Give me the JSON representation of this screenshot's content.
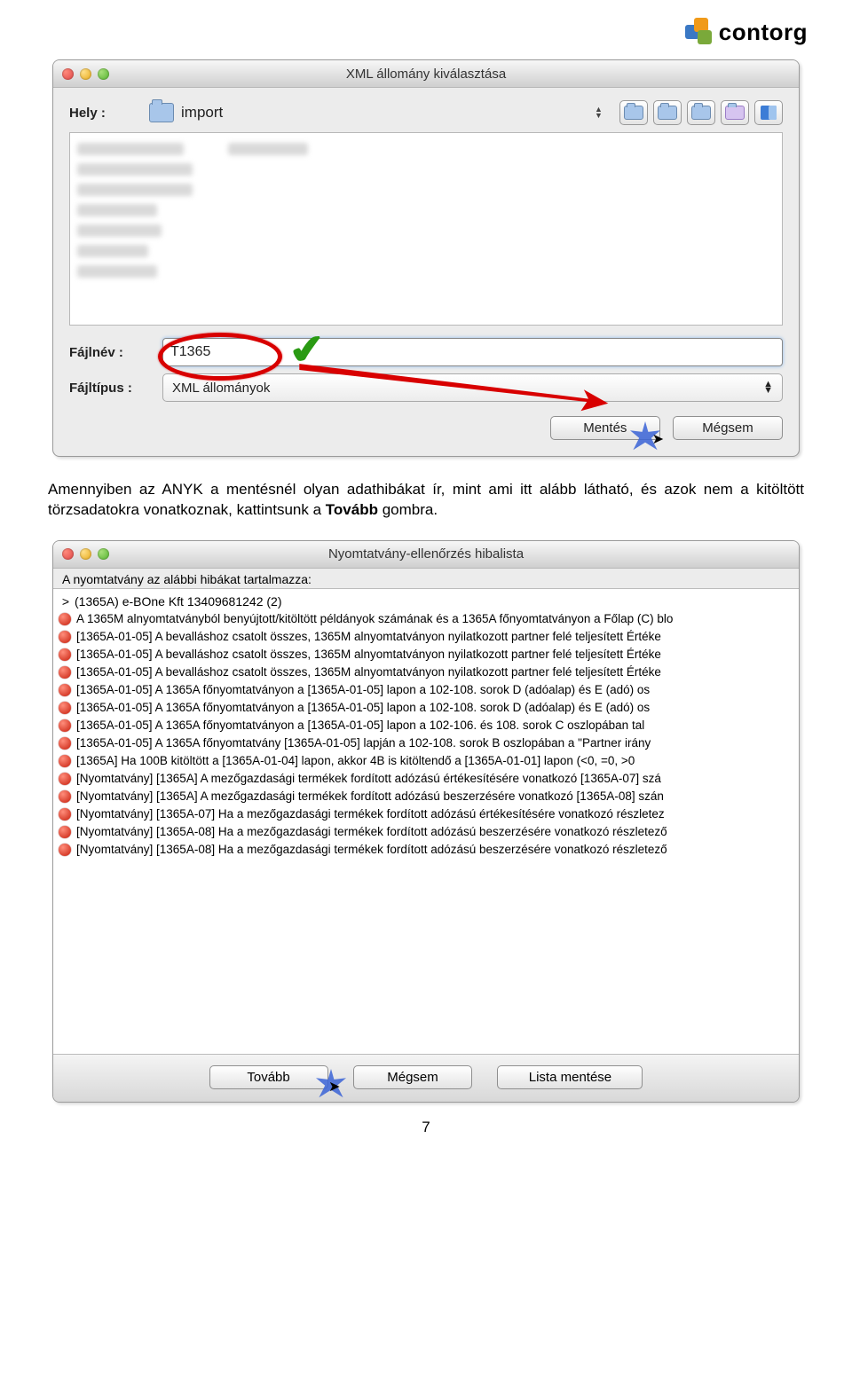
{
  "logo": {
    "text": "contorg"
  },
  "dialog1": {
    "title": "XML állomány kiválasztása",
    "location_label": "Hely :",
    "location_value": "import",
    "filename_label": "Fájlnév :",
    "filename_value": "T1365",
    "filetype_label": "Fájltípus :",
    "filetype_value": "XML állományok",
    "save_btn": "Mentés",
    "cancel_btn": "Mégsem"
  },
  "paragraph": {
    "p1a": "Amennyiben az ANYK a mentésnél olyan adathibákat ír, mint ami itt alább látható, és azok nem a kitöltött törzsadatokra vonatkoznak, kattintsunk a ",
    "p1b": "Tovább",
    "p1c": " gombra."
  },
  "dialog2": {
    "title": "Nyomtatvány-ellenőrzés hibalista",
    "intro": "A nyomtatvány az alábbi hibákat tartalmazza:",
    "header_line": "(1365A) e-BOne Kft 13409681242 (2)",
    "errors": [
      "A 1365M alnyomtatványból benyújtott/kitöltött példányok  számának és a 1365A főnyomtatványon a Főlap (C) blo",
      "[1365A-01-05] A bevalláshoz csatolt összes, 1365M  alnyomtatványon nyilatkozott partner felé teljesített  Értéke",
      "[1365A-01-05] A bevalláshoz csatolt összes, 1365M  alnyomtatványon nyilatkozott partner felé teljesített  Értéke",
      "[1365A-01-05] A bevalláshoz csatolt összes, 1365M  alnyomtatványon nyilatkozott partner felé teljesített  Értéke",
      "[1365A-01-05] A 1365A főnyomtatványon a [1365A-01-05] lapon  a 102-108. sorok D (adóalap) és E (adó) os",
      "[1365A-01-05] A 1365A főnyomtatványon a [1365A-01-05] lapon  a 102-108. sorok D (adóalap) és E (adó) os",
      "[1365A-01-05] A 1365A főnyomtatványon a [1365A-01-05] lapon  a 102-106. és 108. sorok C oszlopában tal",
      "[1365A-01-05] A 1365A főnyomtatvány [1365A-01-05] lapján a  102-108. sorok B oszlopában a \"Partner irány",
      "[1365A]  Ha 100B kitöltött a [1365A-01-04] lapon, akkor 4B  is kitöltendő a [1365A-01-01] lapon (<0, =0, >0",
      "[Nyomtatvány] [1365A]  A mezőgazdasági termékek fordított  adózású értékesítésére vonatkozó [1365A-07] szá",
      "[Nyomtatvány] [1365A]  A mezőgazdasági termékek fordított  adózású beszerzésére vonatkozó [1365A-08] szán",
      "[Nyomtatvány] [1365A-07]  Ha a mezőgazdasági termékek  fordított adózású értékesítésére vonatkozó részletez",
      "[Nyomtatvány] [1365A-08]  Ha a mezőgazdasági termékek  fordított adózású beszerzésére vonatkozó részletező",
      "[Nyomtatvány] [1365A-08]  Ha a mezőgazdasági termékek  fordított adózású beszerzésére vonatkozó részletező"
    ],
    "btn_next": "Tovább",
    "btn_cancel": "Mégsem",
    "btn_savelist": "Lista mentése"
  },
  "page_number": "7"
}
